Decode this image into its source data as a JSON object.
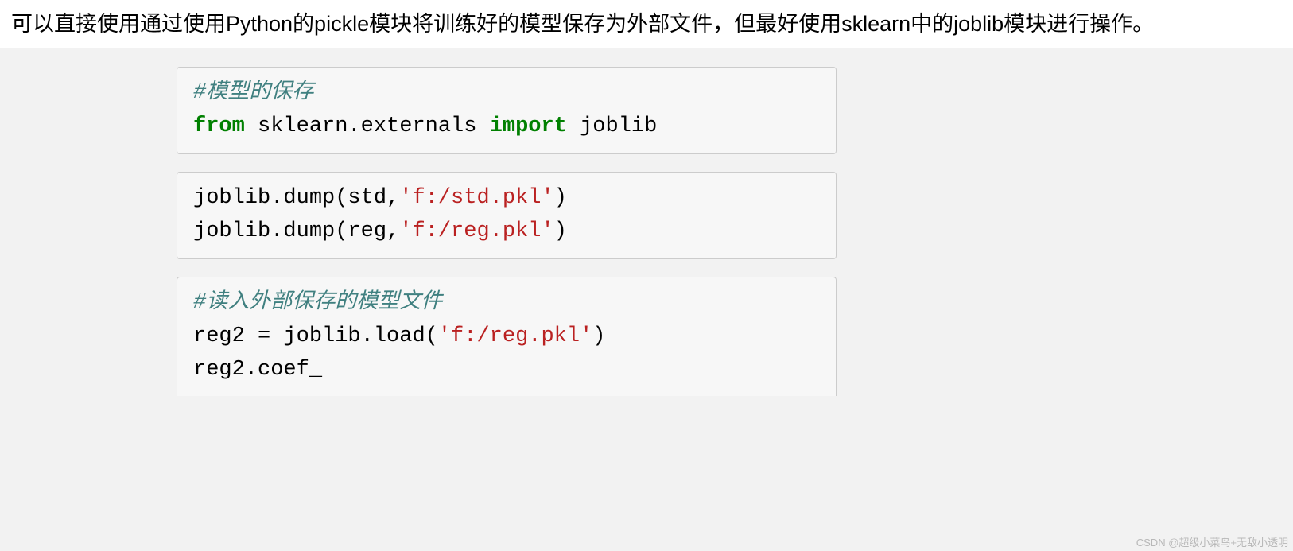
{
  "intro": "可以直接使用通过使用Python的pickle模块将训练好的模型保存为外部文件，但最好使用sklearn中的joblib模块进行操作。",
  "code1": {
    "comment": "#模型的保存",
    "kw_from": "from",
    "mod1": " sklearn.externals ",
    "kw_import": "import",
    "mod2": " joblib"
  },
  "code2": {
    "line1a": "joblib.dump(std,",
    "line1b": "'f:/std.pkl'",
    "line1c": ")",
    "line2a": "joblib.dump(reg,",
    "line2b": "'f:/reg.pkl'",
    "line2c": ")"
  },
  "code3": {
    "comment": "#读入外部保存的模型文件",
    "line1a": "reg2 = joblib.load(",
    "line1b": "'f:/reg.pkl'",
    "line1c": ")",
    "line2": "reg2.coef_"
  },
  "watermark": "CSDN @超级小菜鸟+无敌小透明"
}
